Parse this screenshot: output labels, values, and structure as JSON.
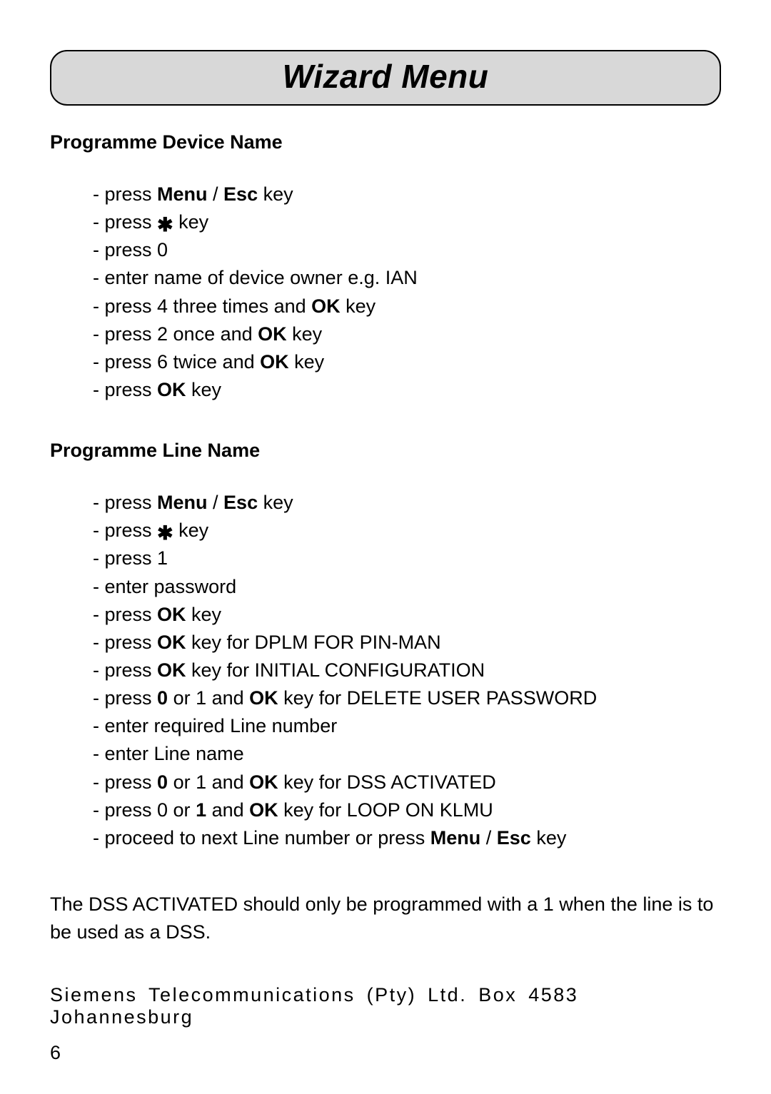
{
  "title": "Wizard Menu",
  "sections": [
    {
      "heading": "Programme Device Name",
      "steps": [
        [
          {
            "t": "press "
          },
          {
            "t": "Menu",
            "b": true
          },
          {
            "t": " / "
          },
          {
            "t": "Esc",
            "b": true
          },
          {
            "t": " key"
          }
        ],
        [
          {
            "t": "press "
          },
          {
            "t": "✱",
            "cls": "asterisk"
          },
          {
            "t": " key"
          }
        ],
        [
          {
            "t": "press 0"
          }
        ],
        [
          {
            "t": "enter name of device owner e.g. IAN"
          }
        ],
        [
          {
            "t": "press 4 three times and "
          },
          {
            "t": "OK",
            "b": true
          },
          {
            "t": " key"
          }
        ],
        [
          {
            "t": "press 2 once and "
          },
          {
            "t": "OK",
            "b": true
          },
          {
            "t": " key"
          }
        ],
        [
          {
            "t": "press 6 twice and "
          },
          {
            "t": "OK",
            "b": true
          },
          {
            "t": " key"
          }
        ],
        [
          {
            "t": "press "
          },
          {
            "t": "OK",
            "b": true
          },
          {
            "t": " key"
          }
        ]
      ]
    },
    {
      "heading": "Programme Line Name",
      "steps": [
        [
          {
            "t": "press "
          },
          {
            "t": "Menu",
            "b": true
          },
          {
            "t": " / "
          },
          {
            "t": "Esc",
            "b": true
          },
          {
            "t": " key"
          }
        ],
        [
          {
            "t": "press "
          },
          {
            "t": "✱",
            "cls": "asterisk"
          },
          {
            "t": " key"
          }
        ],
        [
          {
            "t": "press 1"
          }
        ],
        [
          {
            "t": "enter password"
          }
        ],
        [
          {
            "t": "press "
          },
          {
            "t": "OK",
            "b": true
          },
          {
            "t": " key"
          }
        ],
        [
          {
            "t": "press "
          },
          {
            "t": "OK",
            "b": true
          },
          {
            "t": " key for DPLM FOR PIN-MAN"
          }
        ],
        [
          {
            "t": "press "
          },
          {
            "t": "OK",
            "b": true
          },
          {
            "t": " key for INITIAL CONFIGURATION"
          }
        ],
        [
          {
            "t": "press "
          },
          {
            "t": "0",
            "b": true
          },
          {
            "t": " or 1 and "
          },
          {
            "t": "OK",
            "b": true
          },
          {
            "t": " key for DELETE USER PASSWORD"
          }
        ],
        [
          {
            "t": "enter required Line number"
          }
        ],
        [
          {
            "t": "enter Line name"
          }
        ],
        [
          {
            "t": "press "
          },
          {
            "t": "0",
            "b": true
          },
          {
            "t": " or 1 and "
          },
          {
            "t": "OK",
            "b": true
          },
          {
            "t": " key for DSS ACTIVATED"
          }
        ],
        [
          {
            "t": "press 0 or "
          },
          {
            "t": "1",
            "b": true
          },
          {
            "t": " and "
          },
          {
            "t": "OK",
            "b": true
          },
          {
            "t": " key for LOOP ON KLMU"
          }
        ],
        [
          {
            "t": "proceed to next Line number or press "
          },
          {
            "t": "Menu",
            "b": true
          },
          {
            "t": " / "
          },
          {
            "t": "Esc",
            "b": true
          },
          {
            "t": " key"
          }
        ]
      ]
    }
  ],
  "note": "The DSS ACTIVATED should only be programmed with a 1 when the line is to be used as a DSS.",
  "footer_company": "Siemens Telecommunications (Pty) Ltd. Box 4583 Johannesburg",
  "page_number": "6"
}
